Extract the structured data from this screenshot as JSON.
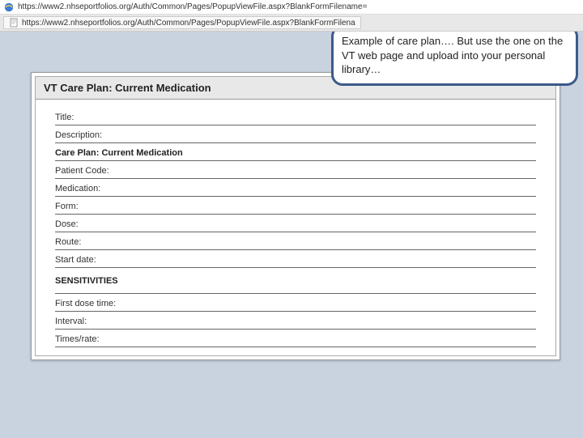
{
  "browser": {
    "url": "https://www2.nhseportfolios.org/Auth/Common/Pages/PopupViewFile.aspx?BlankFormFilename=",
    "tab_url": "https://www2.nhseportfolios.org/Auth/Common/Pages/PopupViewFile.aspx?BlankFormFilena"
  },
  "callout": {
    "text": "Example of care plan…. But use the one on the VT web page and upload into your personal library…"
  },
  "document": {
    "title": "VT Care Plan: Current Medication",
    "fields": {
      "title": "Title:",
      "description": "Description:",
      "care_plan": "Care Plan: Current Medication",
      "patient_code": "Patient Code:",
      "medication": "Medication:",
      "form": "Form:",
      "dose": "Dose:",
      "route": "Route:",
      "start_date": "Start date:",
      "sensitivities": "SENSITIVITIES",
      "first_dose_time": "First dose time:",
      "interval": "Interval:",
      "times_rate": "Times/rate:"
    }
  }
}
